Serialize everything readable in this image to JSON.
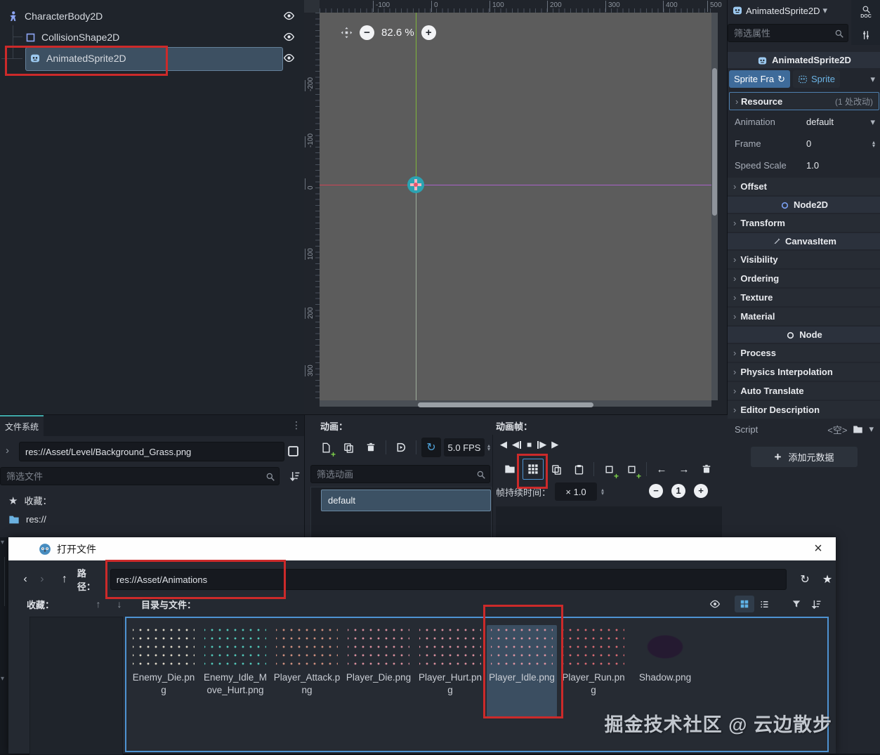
{
  "icons": {
    "minus": "−",
    "plus": "+",
    "chevron_down": "▾",
    "chevron_right": "›",
    "nav_back": "‹",
    "arrow_up": "↑",
    "arrow_down": "↓",
    "loop": "↻",
    "star": "★",
    "dots": "⋮",
    "play": "▶",
    "play_back": "◀",
    "stop": "■",
    "move_left": "←",
    "move_right": "→",
    "spin_up": "▴",
    "spin_down": "▾",
    "close": "×",
    "doc_label": "DOC",
    "times_one": "1"
  },
  "colors": {
    "accent_blue": "#5fb2e6",
    "selection": "#3d5062",
    "annotation_red": "#cc2a2a",
    "tab_teal": "#3fa9a9",
    "canvas_gray": "#5c5c5c",
    "axis_green": "#7fb63a",
    "axis_red": "#cf4356",
    "axis_purple": "#a963c9",
    "gizmo_teal": "#2ba3b2",
    "frames_tab_blue": "#3e6b9a"
  },
  "scene_tree": {
    "nodes": [
      {
        "label": "CharacterBody2D",
        "icon": "character-body-icon"
      },
      {
        "label": "CollisionShape2D",
        "icon": "collision-shape-icon"
      },
      {
        "label": "AnimatedSprite2D",
        "icon": "animated-sprite-icon",
        "selected": true
      }
    ]
  },
  "viewport": {
    "zoom": "82.6 %",
    "h_ruler": [
      "-100",
      "0",
      "100",
      "200",
      "300",
      "400",
      "500"
    ],
    "v_ruler": [
      "-200",
      "-100",
      "0",
      "100",
      "200",
      "300"
    ]
  },
  "inspector": {
    "node_name": "AnimatedSprite2D",
    "filter_placeholder": "筛选属性",
    "title": "AnimatedSprite2D",
    "frames_btn": "Sprite Fra",
    "sprite_btn": "Sprite",
    "resource": {
      "label": "Resource",
      "changes": "(1 处改动)"
    },
    "props": {
      "animation": {
        "label": "Animation",
        "value": "default"
      },
      "frame": {
        "label": "Frame",
        "value": "0"
      },
      "speed": {
        "label": "Speed Scale",
        "value": "1.0"
      }
    },
    "sections": {
      "offset": "Offset",
      "transform": "Transform",
      "visibility": "Visibility",
      "ordering": "Ordering",
      "texture": "Texture",
      "material": "Material",
      "process": "Process",
      "physics": "Physics Interpolation",
      "auto_translate": "Auto Translate",
      "editor_description": "Editor Description"
    },
    "categories": {
      "node2d": "Node2D",
      "canvas_item": "CanvasItem",
      "node": "Node"
    },
    "script": {
      "label": "Script",
      "value": "<空>"
    },
    "add_metadata": "添加元数据"
  },
  "sprite_frames": {
    "anim_label": "动画：",
    "frames_label": "动画帧：",
    "fps": "5.0 FPS",
    "filter_placeholder": "筛选动画",
    "selected_animation": "default",
    "duration_label": "帧持续时间：",
    "duration_value": "× 1.0",
    "zoom_reset": "1"
  },
  "filesystem": {
    "tab": "文件系统",
    "path": "res://Asset/Level/Background_Grass.png",
    "filter_placeholder": "筛选文件",
    "favorites_label": "收藏：",
    "root_path": "res://"
  },
  "file_dialog": {
    "title": "打开文件",
    "path_label": "路径：",
    "path_value": "res://Asset/Animations",
    "favorites_label": "收藏：",
    "dir_label": "目录与文件：",
    "files": [
      {
        "name": "Enemy_Die.png",
        "tint": "#ded8c8"
      },
      {
        "name": "Enemy_Idle_Move_Hurt.png",
        "tint": "#52c7b8"
      },
      {
        "name": "Player_Attack.png",
        "tint": "#cf8f7e"
      },
      {
        "name": "Player_Die.png",
        "tint": "#d98f9d"
      },
      {
        "name": "Player_Hurt.png",
        "tint": "#d98f9d"
      },
      {
        "name": "Player_Idle.png",
        "tint": "#db93a0",
        "selected": true
      },
      {
        "name": "Player_Run.png",
        "tint": "#d96a72"
      },
      {
        "name": "Shadow.png",
        "tint": "#251a31",
        "shape": "blob"
      }
    ]
  },
  "watermark": "掘金技术社区 @ 云边散步"
}
